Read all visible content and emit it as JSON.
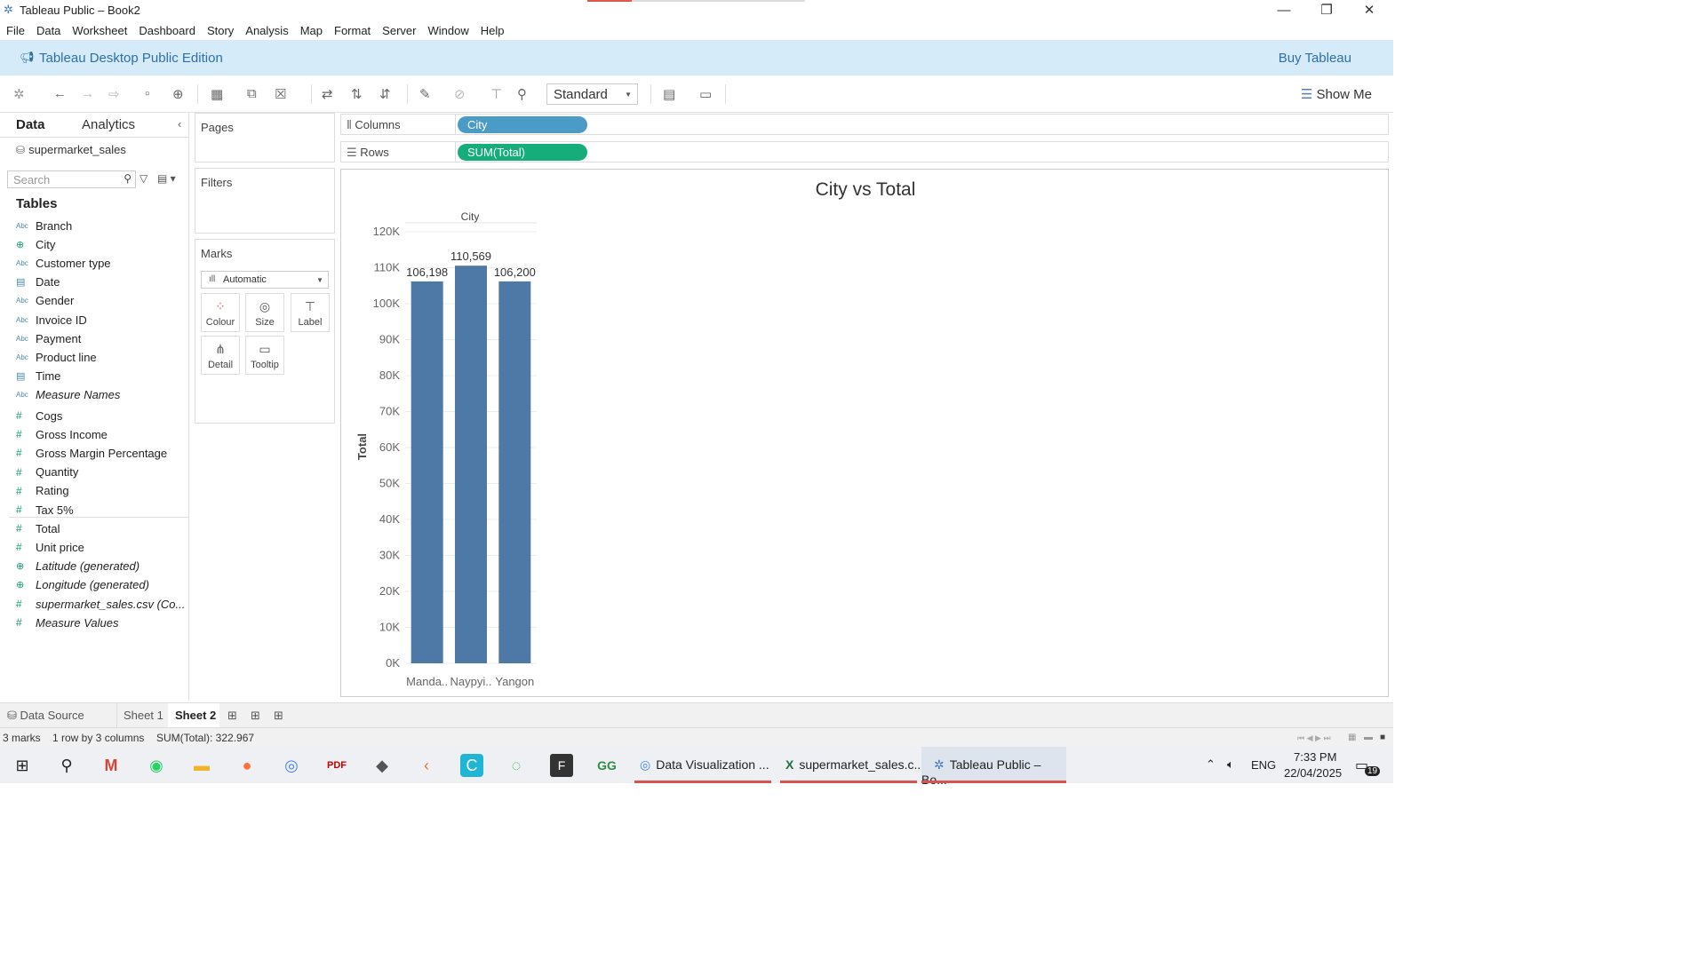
{
  "window": {
    "title": "Tableau Public – Book2",
    "minimize": "—",
    "restore": "❐",
    "close": "✕"
  },
  "menu": [
    "File",
    "Data",
    "Worksheet",
    "Dashboard",
    "Story",
    "Analysis",
    "Map",
    "Format",
    "Server",
    "Window",
    "Help"
  ],
  "banner": {
    "edition": "Tableau Desktop Public Edition",
    "buy": "Buy Tableau"
  },
  "toolbar": {
    "fit": "Standard",
    "show_me": "Show Me"
  },
  "datapane": {
    "tab_data": "Data",
    "tab_analytics": "Analytics",
    "datasource": "supermarket_sales",
    "search_placeholder": "Search",
    "tables_heading": "Tables",
    "dimensions": [
      {
        "icon": "Abc",
        "name": "Branch"
      },
      {
        "icon": "globe",
        "name": "City"
      },
      {
        "icon": "Abc",
        "name": "Customer type"
      },
      {
        "icon": "calendar",
        "name": "Date"
      },
      {
        "icon": "Abc",
        "name": "Gender"
      },
      {
        "icon": "Abc",
        "name": "Invoice ID"
      },
      {
        "icon": "Abc",
        "name": "Payment"
      },
      {
        "icon": "Abc",
        "name": "Product line"
      },
      {
        "icon": "calendar",
        "name": "Time"
      },
      {
        "icon": "Abc",
        "name": "Measure Names"
      }
    ],
    "measures": [
      {
        "icon": "#",
        "name": "Cogs"
      },
      {
        "icon": "#",
        "name": "Gross Income"
      },
      {
        "icon": "#",
        "name": "Gross Margin Percentage"
      },
      {
        "icon": "#",
        "name": "Quantity"
      },
      {
        "icon": "#",
        "name": "Rating"
      },
      {
        "icon": "#",
        "name": "Tax 5%"
      },
      {
        "icon": "#",
        "name": "Total"
      },
      {
        "icon": "#",
        "name": "Unit price"
      },
      {
        "icon": "globe",
        "name": "Latitude (generated)"
      },
      {
        "icon": "globe",
        "name": "Longitude (generated)"
      },
      {
        "icon": "#",
        "name": "supermarket_sales.csv (Co..."
      },
      {
        "icon": "#",
        "name": "Measure Values"
      }
    ]
  },
  "cards": {
    "pages": "Pages",
    "filters": "Filters",
    "marks": "Marks",
    "mark_type": "Automatic",
    "buttons": [
      "Colour",
      "Size",
      "Label",
      "Detail",
      "Tooltip"
    ]
  },
  "shelves": {
    "columns_label": "Columns",
    "columns_pill": "City",
    "rows_label": "Rows",
    "rows_pill": "SUM(Total)"
  },
  "chart_data": {
    "type": "bar",
    "title": "City vs Total",
    "xlabel": "City",
    "ylabel": "Total",
    "categories": [
      "Manda..",
      "Naypyi..",
      "Yangon"
    ],
    "values": [
      106198,
      110569,
      106200
    ],
    "data_labels": [
      "106,198",
      "110,569",
      "106,200"
    ],
    "ylim": [
      0,
      120000
    ],
    "yticks": [
      0,
      10000,
      20000,
      30000,
      40000,
      50000,
      60000,
      70000,
      80000,
      90000,
      100000,
      110000,
      120000
    ],
    "ytick_labels": [
      "0K",
      "10K",
      "20K",
      "30K",
      "40K",
      "50K",
      "60K",
      "70K",
      "80K",
      "90K",
      "100K",
      "110K",
      "120K"
    ],
    "bar_color": "#4e79a7",
    "grid": true
  },
  "tabs": {
    "data_source": "Data Source",
    "sheet1": "Sheet 1",
    "sheet2": "Sheet 2"
  },
  "status": {
    "marks": "3 marks",
    "dims": "1 row by 3 columns",
    "sum": "SUM(Total): 322.967"
  },
  "taskbar": {
    "task1": "Data Visualization ...",
    "task2": "supermarket_sales.c...",
    "task3": "Tableau Public – Bo...",
    "lang": "ENG",
    "time": "7:33 PM",
    "date": "22/04/2025",
    "notif_count": "19"
  },
  "colors": {
    "columns_pill": "#4a9cc7",
    "rows_pill": "#15ad7a",
    "banner": "#d6ebfa",
    "accent": "#2e6fa8"
  }
}
